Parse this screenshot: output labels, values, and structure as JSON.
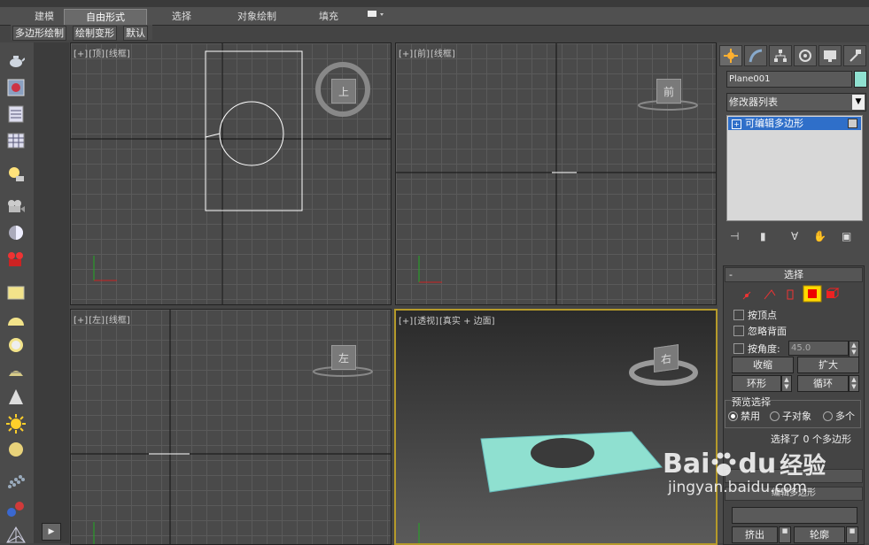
{
  "ribbon": {
    "tabs": [
      "建模",
      "自由形式",
      "选择",
      "对象绘制",
      "填充"
    ],
    "active_tab": "自由形式"
  },
  "subtoolbar": {
    "buttons": [
      "多边形绘制",
      "绘制变形",
      "默认"
    ]
  },
  "left_toolbar": {
    "icons": [
      "teapot-icon",
      "material-icon",
      "layer-icon",
      "table-icon",
      "light-icon",
      "camera-icon",
      "sphere-icon",
      "render-icon",
      "box-icon",
      "dome-icon",
      "ring-icon",
      "cone-icon",
      "sun-icon",
      "disc-icon",
      "particles-icon",
      "molecule-icon",
      "pyramid-icon"
    ]
  },
  "viewports": {
    "top": {
      "plus": "[+]",
      "name": "[顶]",
      "mode": "[线框]",
      "cube_label": "上"
    },
    "front": {
      "plus": "[+]",
      "name": "[前]",
      "mode": "[线框]",
      "cube_label": "前"
    },
    "left": {
      "plus": "[+]",
      "name": "[左]",
      "mode": "[线框]",
      "cube_label": "左"
    },
    "perspective": {
      "plus": "[+]",
      "name": "[透视]",
      "mode": "[真实 + 边面]",
      "cube_label": "右"
    }
  },
  "command_panel": {
    "object_name": "Plane001",
    "object_color": "#8fe0d0",
    "modifier_list_label": "修改器列表",
    "modifier_stack": [
      "可编辑多边形"
    ]
  },
  "selection_rollout": {
    "title": "选择",
    "collapse": "-",
    "by_vertex": "按顶点",
    "ignore_backface": "忽略背面",
    "by_angle": "按角度:",
    "angle_value": "45.0",
    "shrink": "收缩",
    "grow": "扩大",
    "ring": "环形",
    "loop": "循环",
    "preview_title": "预览选择",
    "preview_options": [
      "禁用",
      "子对象",
      "多个"
    ],
    "preview_selected": "禁用",
    "status": "选择了 0 个多边形",
    "extrude": "挤出",
    "outline": "轮廓",
    "edit_polygon": "编辑多边形"
  },
  "watermark": {
    "brand": "Bai",
    "brand_tail": "du",
    "cn": "经验",
    "url": "jingyan.baidu.com"
  },
  "colors": {
    "accent_active": "#2f6fc9",
    "plane_color": "#8fe0d0",
    "selected_mode": "#ff0000",
    "viewport_border_active": "#b59a2a"
  }
}
